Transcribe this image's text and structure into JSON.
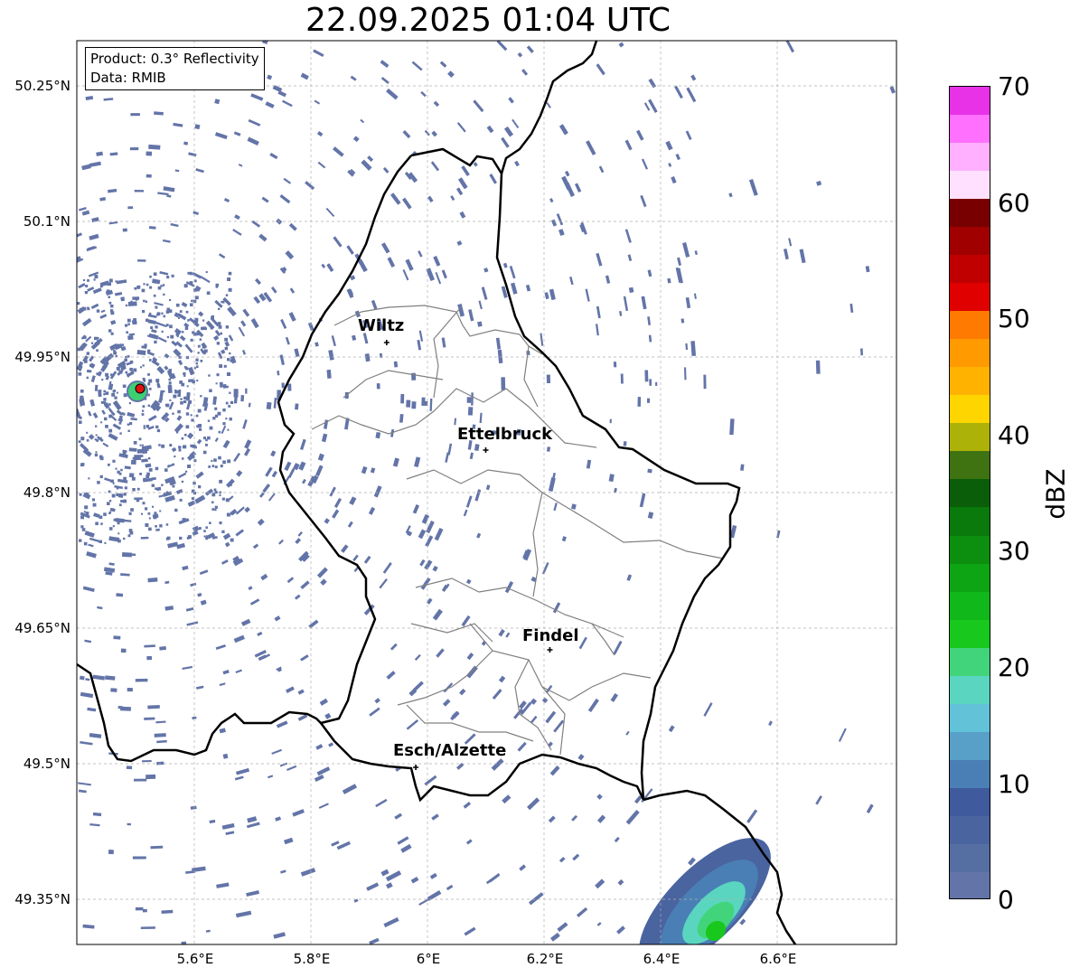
{
  "title": "22.09.2025 01:04 UTC",
  "info": {
    "product": "Product: 0.3° Reflectivity",
    "data": "Data: RMIB"
  },
  "axes": {
    "lat_labels": [
      "50.25°N",
      "50.1°N",
      "49.95°N",
      "49.8°N",
      "49.65°N",
      "49.5°N",
      "49.35°N"
    ],
    "lon_labels": [
      "5.6°E",
      "5.8°E",
      "6°E",
      "6.2°E",
      "6.4°E",
      "6.6°E"
    ]
  },
  "cities": [
    {
      "name": "Wiltz",
      "lon": 5.93,
      "lat": 49.966
    },
    {
      "name": "Ettelbruck",
      "lon": 6.1,
      "lat": 49.847
    },
    {
      "name": "Findel",
      "lon": 6.21,
      "lat": 49.626
    },
    {
      "name": "Esch/Alzette",
      "lon": 5.98,
      "lat": 49.496
    }
  ],
  "radar_site": {
    "lon": 5.505,
    "lat": 49.915
  },
  "colorbar": {
    "label": "dBZ",
    "min": 0,
    "max": 70,
    "ticks": [
      "0",
      "10",
      "20",
      "30",
      "40",
      "50",
      "60",
      "70"
    ],
    "colors": [
      "#6374a8",
      "#566fa3",
      "#4a64a0",
      "#3f5a9d",
      "#4a7fb5",
      "#58a0c8",
      "#62c2d8",
      "#5ad6c0",
      "#42d47a",
      "#18c81c",
      "#10b81a",
      "#0ea514",
      "#0c8f0f",
      "#0a7a0c",
      "#0a5e0a",
      "#3f7312",
      "#adb209",
      "#ffd500",
      "#ffb300",
      "#ff9a00",
      "#ff7a00",
      "#e00000",
      "#c00000",
      "#a00000",
      "#780000",
      "#ffe0ff",
      "#ffb0ff",
      "#ff70ff",
      "#e832e8"
    ]
  },
  "echo_color": "#6374a8",
  "border_color": "#000000",
  "canton_color": "#808080"
}
